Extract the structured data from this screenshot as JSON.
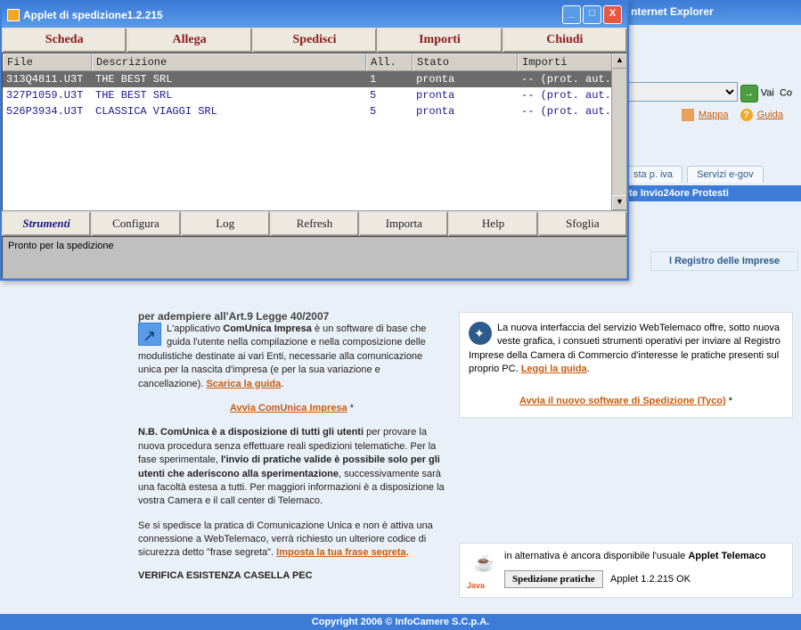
{
  "ie": {
    "title_fragment": "nternet Explorer",
    "go_label": "Vai",
    "co_fragment": "Co",
    "mappa": "Mappa",
    "guida": "Guida",
    "tab_piva": "sta p. iva",
    "tab_egov": "Servizi e-gov",
    "blue_bar": "te    Invio24ore   Protesti",
    "registro": "l Registro delle Imprese"
  },
  "applet": {
    "title": "Applet di spedizione1.2.215",
    "top_btns": {
      "scheda": "Scheda",
      "allega": "Allega",
      "spedisci": "Spedisci",
      "importi": "Importi",
      "chiudi": "Chiudi"
    },
    "headers": {
      "file": "File",
      "desc": "Descrizione",
      "all": "All.",
      "stato": "Stato",
      "imp": "Importi"
    },
    "rows": [
      {
        "file": "313Q4811.U3T",
        "desc": "THE BEST SRL",
        "all": "1",
        "stato": "pronta",
        "imp": "-- (prot. aut.)"
      },
      {
        "file": "327P1059.U3T",
        "desc": "THE BEST SRL",
        "all": "5",
        "stato": "pronta",
        "imp": "-- (prot. aut.)"
      },
      {
        "file": "526P3934.U3T",
        "desc": "CLASSICA VIAGGI SRL",
        "all": "5",
        "stato": "pronta",
        "imp": "-- (prot. aut.)"
      }
    ],
    "bottom_btns": {
      "strumenti": "Strumenti",
      "configura": "Configura",
      "log": "Log",
      "refresh": "Refresh",
      "importa": "Importa",
      "help": "Help",
      "sfoglia": "Sfoglia"
    },
    "status": "Pronto per la spedizione"
  },
  "left": {
    "cut": "per adempiere all'Art.9 Legge 40/2007",
    "p1a": "L'applicativo ",
    "p1b": "ComUnica Impresa",
    "p1c": " è un software di base che guida l'utente nella compilazione e nella composizione delle modulistiche destinate ai vari Enti, necessarie alla comunicazione unica per la nascita d'impresa (e per la sua variazione e cancellazione). ",
    "scarica": "Scarica la guida",
    "avvia": "Avvia ComUnica Impresa",
    "p2a": "N.B. ComUnica è a disposizione di tutti gli utenti",
    "p2b": " per provare la nuova procedura senza effettuare reali spedizioni telematiche. Per la fase sperimentale, ",
    "p2c": "l'invio di pratiche valide è possibile solo per gli utenti che aderiscono alla sperimentazione",
    "p2d": ", successivamente sarà una facoltà estesa a tutti. Per maggiori informazioni è a disposizione la vostra Camera e il call center di Telemaco.",
    "p3a": "Se si spedisce la pratica di Comunicazione Unica e non è attiva una connessione a WebTelemaco, verrà richiesto un ulteriore codice di sicurezza detto \"frase segreta\". ",
    "imposta": "Imposta la tua frase segreta",
    "verif": "VERIFICA ESISTENZA CASELLA PEC"
  },
  "right": {
    "p1": "La nuova interfaccia del servizio WebTelemaco offre, sotto nuova veste grafica, i consueti strumenti operativi per inviare al Registro Imprese della Camera di Commercio d'interesse le pratiche presenti sul proprio PC. ",
    "leggi": "Leggi la guida",
    "avvia": "Avvia il nuovo software di Spedizione (Tyco)"
  },
  "java": {
    "text1": "in alternativa è ancora disponibile l'usuale ",
    "text1b": "Applet Telemaco",
    "btn": "Spedizione pratiche",
    "ok": "Applet 1.2.215 OK",
    "logo": "Java"
  },
  "footer": "Copyright 2006 © InfoCamere S.C.p.A."
}
